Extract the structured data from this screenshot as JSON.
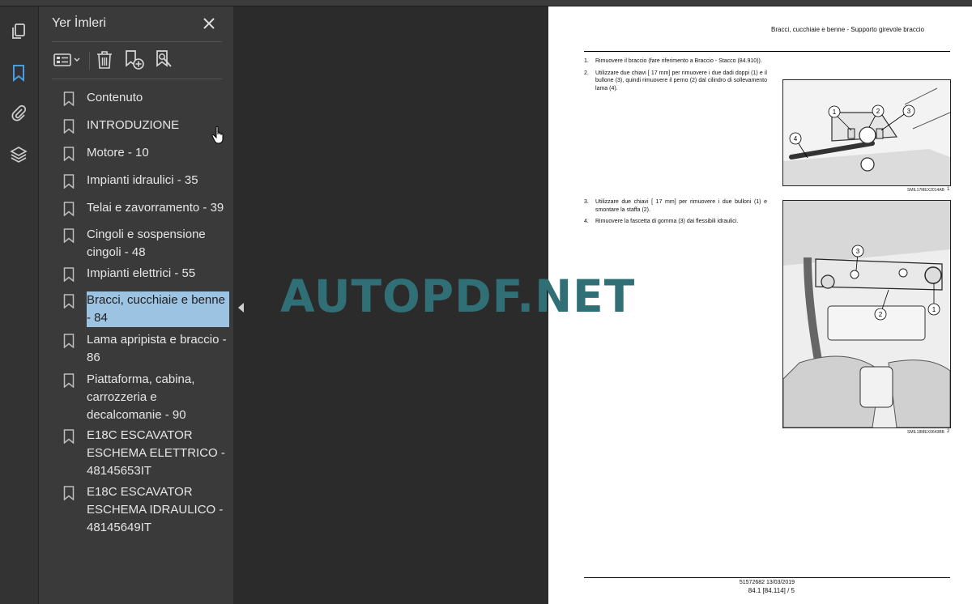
{
  "panel": {
    "title": "Yer İmleri"
  },
  "rail": {
    "icons": [
      "pages-icon",
      "bookmark-icon",
      "attachment-icon",
      "layers-icon"
    ]
  },
  "toolbar": {
    "icons": [
      "options-icon",
      "delete-icon",
      "add-bookmark-icon",
      "find-bookmark-icon"
    ]
  },
  "bookmarks": [
    {
      "label": "Contenuto"
    },
    {
      "label": "INTRODUZIONE"
    },
    {
      "label": "Motore - 10"
    },
    {
      "label": "Impianti idraulici - 35"
    },
    {
      "label": "Telai e zavorramento - 39"
    },
    {
      "label": "Cingoli e sospensione cingoli - 48"
    },
    {
      "label": "Impianti elettrici - 55"
    },
    {
      "label": "Bracci, cucchiaie e benne - 84",
      "selected": true
    },
    {
      "label": "Lama apripista e braccio - 86"
    },
    {
      "label": "Piattaforma, cabina, carrozzeria e decalcomanie - 90"
    },
    {
      "label": "E18C ESCAVATOR ESCHEMA ELETTRICO - 48145653IT"
    },
    {
      "label": "E18C ESCAVATOR ESCHEMA IDRAULICO - 48145649IT"
    }
  ],
  "document": {
    "header": "Bracci, cucchiaie e benne - Supporto girevole braccio",
    "steps_a": [
      {
        "num": "1.",
        "text": "Rimuovere il braccio (fare riferimento a Braccio - Stacco (84.910))."
      },
      {
        "num": "2.",
        "text": "Utilizzare due chiavi [ 17 mm] per rimuovere i due dadi doppi (1) e il bullone (3), quindi rimuovere il perno (2) dal cilindro di sollevamento lama (4)."
      }
    ],
    "steps_b": [
      {
        "num": "3.",
        "text": "Utilizzare due chiavi [ 17 mm] per rimuovere i due bulloni (1) e smontare la staffa (2)."
      },
      {
        "num": "4.",
        "text": "Rimuovere la fascetta di gomma (3) dai flessibili idraulici."
      }
    ],
    "figure1": {
      "caption": "SMIL17MEX2014AB",
      "number": "1",
      "callouts": [
        "1",
        "2",
        "3",
        "4"
      ]
    },
    "figure2": {
      "caption": "SMIL18MEX0643BB",
      "number": "2",
      "callouts": [
        "3",
        "2",
        "1"
      ]
    },
    "footer_code": "51572682 13/03/2019",
    "footer_page": "84.1 [84.114] / 5"
  },
  "watermark": "AUTOPDF.NET",
  "colors": {
    "panel_bg": "#3a3a3a",
    "selection": "#9dc3e2",
    "active_icon": "#4a9de0",
    "watermark": "#2f6f75"
  }
}
